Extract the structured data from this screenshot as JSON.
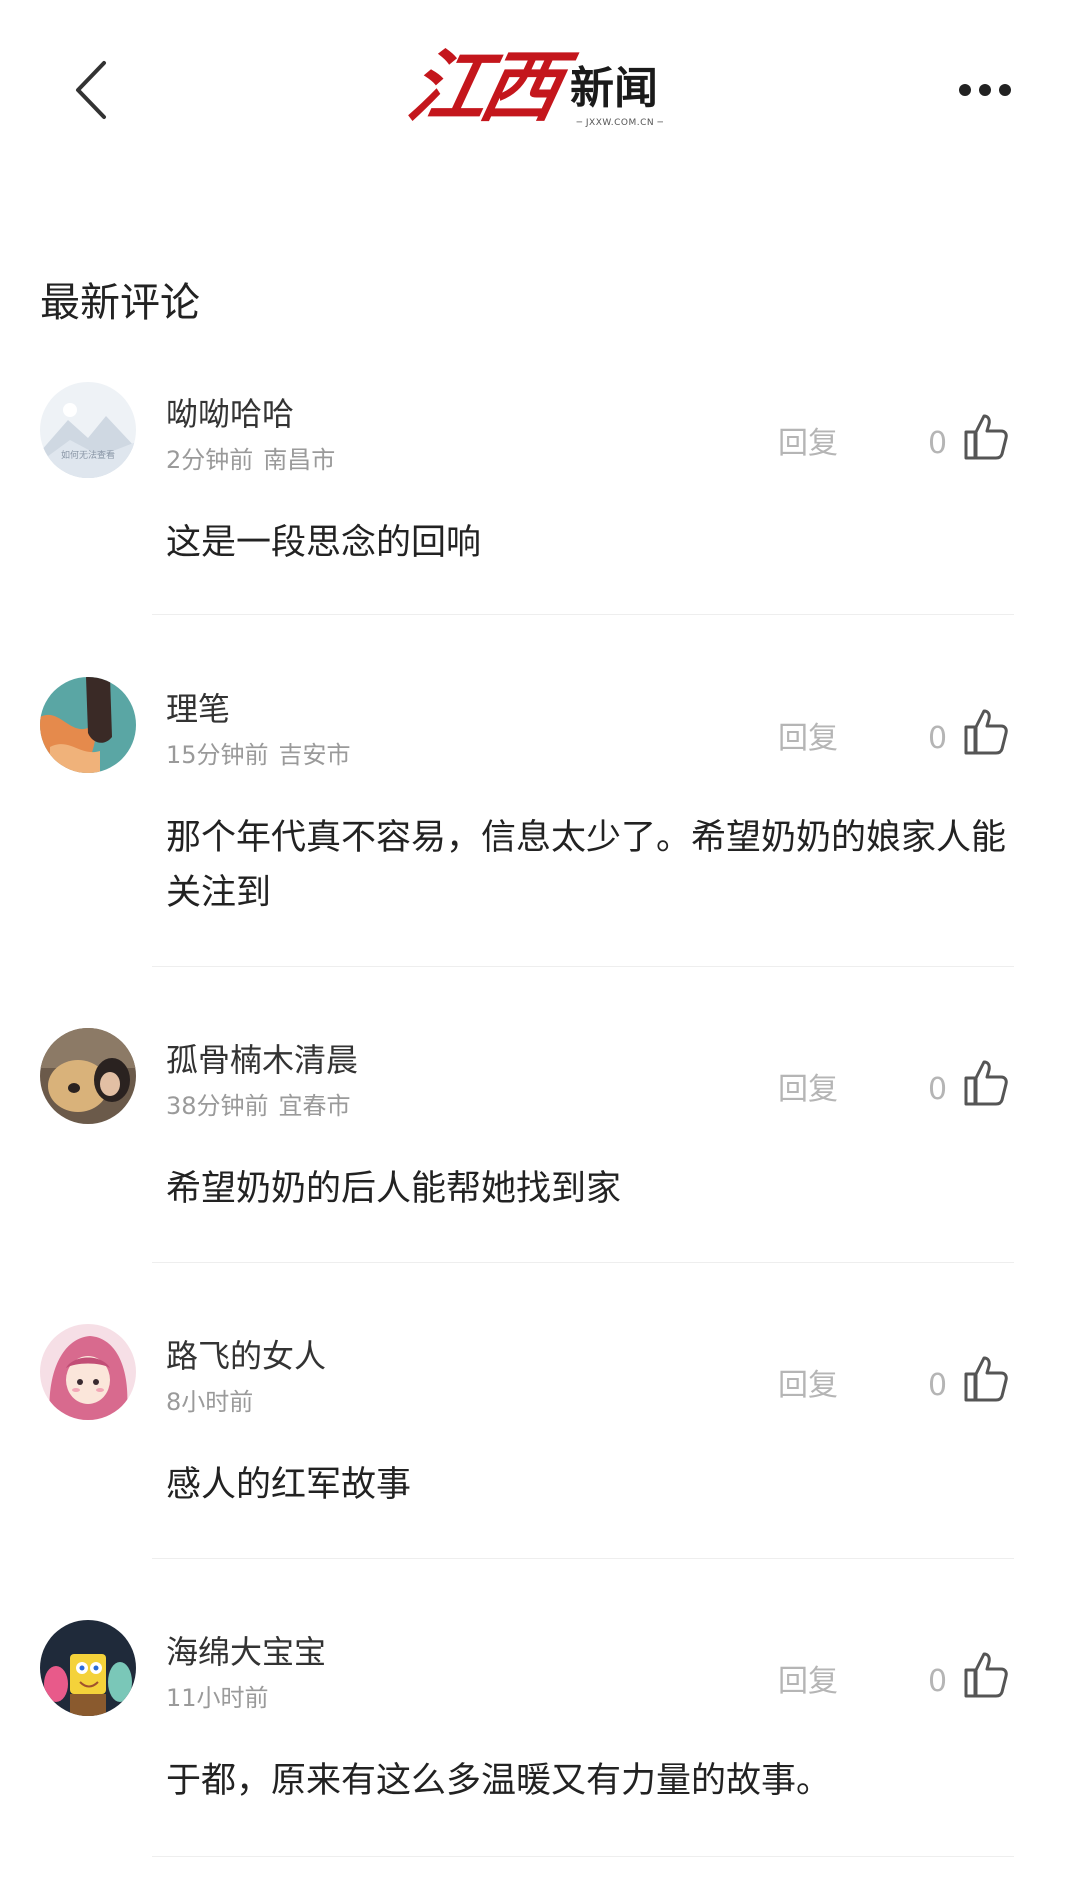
{
  "header": {
    "logo_brush_text": "江西",
    "logo_text": "新闻",
    "logo_url": "─ JXXW.COM.CN ─",
    "back_icon": "chevron-left-icon",
    "more_icon": "more-horizontal-icon"
  },
  "section_title": "最新评论",
  "reply_label": "回复",
  "colors": {
    "brand_red": "#c4161c",
    "meta_gray": "#9a9a9a",
    "action_gray": "#b5b5b5"
  },
  "comments": [
    {
      "username": "呦呦哈哈",
      "time": "2分钟前",
      "location": "南昌市",
      "text": "这是一段思念的回响",
      "likes": "0",
      "avatar_caption": "如何无法查看"
    },
    {
      "username": "理笔",
      "time": "15分钟前",
      "location": "吉安市",
      "text": "那个年代真不容易，信息太少了。希望奶奶的娘家人能关注到",
      "likes": "0"
    },
    {
      "username": "孤骨楠木清晨",
      "time": "38分钟前",
      "location": "宜春市",
      "text": "希望奶奶的后人能帮她找到家",
      "likes": "0"
    },
    {
      "username": "路飞的女人",
      "time": "8小时前",
      "location": "",
      "text": "感人的红军故事",
      "likes": "0"
    },
    {
      "username": "海绵大宝宝",
      "time": "11小时前",
      "location": "",
      "text": "于都，原来有这么多温暖又有力量的故事。",
      "likes": "0"
    }
  ]
}
